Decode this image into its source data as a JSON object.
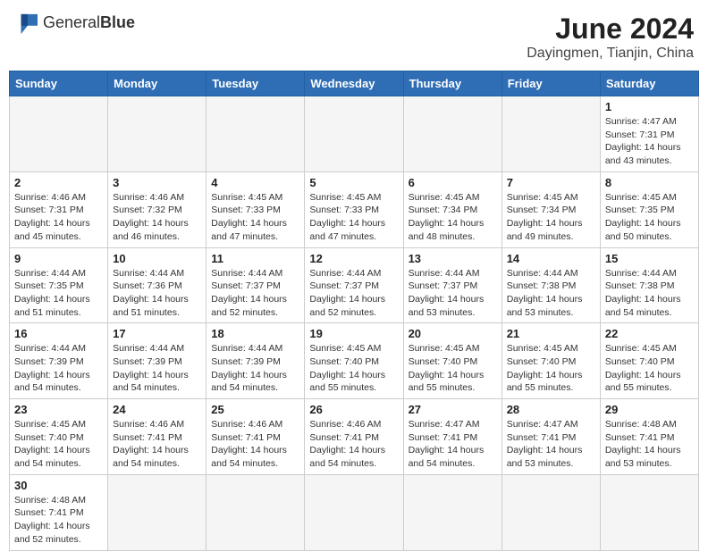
{
  "header": {
    "logo_general": "General",
    "logo_blue": "Blue",
    "month_title": "June 2024",
    "subtitle": "Dayingmen, Tianjin, China"
  },
  "weekdays": [
    "Sunday",
    "Monday",
    "Tuesday",
    "Wednesday",
    "Thursday",
    "Friday",
    "Saturday"
  ],
  "weeks": [
    [
      {
        "day": "",
        "info": ""
      },
      {
        "day": "",
        "info": ""
      },
      {
        "day": "",
        "info": ""
      },
      {
        "day": "",
        "info": ""
      },
      {
        "day": "",
        "info": ""
      },
      {
        "day": "",
        "info": ""
      },
      {
        "day": "1",
        "info": "Sunrise: 4:47 AM\nSunset: 7:31 PM\nDaylight: 14 hours\nand 43 minutes."
      }
    ],
    [
      {
        "day": "2",
        "info": "Sunrise: 4:46 AM\nSunset: 7:31 PM\nDaylight: 14 hours\nand 45 minutes."
      },
      {
        "day": "3",
        "info": "Sunrise: 4:46 AM\nSunset: 7:32 PM\nDaylight: 14 hours\nand 46 minutes."
      },
      {
        "day": "4",
        "info": "Sunrise: 4:45 AM\nSunset: 7:33 PM\nDaylight: 14 hours\nand 47 minutes."
      },
      {
        "day": "5",
        "info": "Sunrise: 4:45 AM\nSunset: 7:33 PM\nDaylight: 14 hours\nand 47 minutes."
      },
      {
        "day": "6",
        "info": "Sunrise: 4:45 AM\nSunset: 7:34 PM\nDaylight: 14 hours\nand 48 minutes."
      },
      {
        "day": "7",
        "info": "Sunrise: 4:45 AM\nSunset: 7:34 PM\nDaylight: 14 hours\nand 49 minutes."
      },
      {
        "day": "8",
        "info": "Sunrise: 4:45 AM\nSunset: 7:35 PM\nDaylight: 14 hours\nand 50 minutes."
      }
    ],
    [
      {
        "day": "9",
        "info": "Sunrise: 4:44 AM\nSunset: 7:35 PM\nDaylight: 14 hours\nand 51 minutes."
      },
      {
        "day": "10",
        "info": "Sunrise: 4:44 AM\nSunset: 7:36 PM\nDaylight: 14 hours\nand 51 minutes."
      },
      {
        "day": "11",
        "info": "Sunrise: 4:44 AM\nSunset: 7:37 PM\nDaylight: 14 hours\nand 52 minutes."
      },
      {
        "day": "12",
        "info": "Sunrise: 4:44 AM\nSunset: 7:37 PM\nDaylight: 14 hours\nand 52 minutes."
      },
      {
        "day": "13",
        "info": "Sunrise: 4:44 AM\nSunset: 7:37 PM\nDaylight: 14 hours\nand 53 minutes."
      },
      {
        "day": "14",
        "info": "Sunrise: 4:44 AM\nSunset: 7:38 PM\nDaylight: 14 hours\nand 53 minutes."
      },
      {
        "day": "15",
        "info": "Sunrise: 4:44 AM\nSunset: 7:38 PM\nDaylight: 14 hours\nand 54 minutes."
      }
    ],
    [
      {
        "day": "16",
        "info": "Sunrise: 4:44 AM\nSunset: 7:39 PM\nDaylight: 14 hours\nand 54 minutes."
      },
      {
        "day": "17",
        "info": "Sunrise: 4:44 AM\nSunset: 7:39 PM\nDaylight: 14 hours\nand 54 minutes."
      },
      {
        "day": "18",
        "info": "Sunrise: 4:44 AM\nSunset: 7:39 PM\nDaylight: 14 hours\nand 54 minutes."
      },
      {
        "day": "19",
        "info": "Sunrise: 4:45 AM\nSunset: 7:40 PM\nDaylight: 14 hours\nand 55 minutes."
      },
      {
        "day": "20",
        "info": "Sunrise: 4:45 AM\nSunset: 7:40 PM\nDaylight: 14 hours\nand 55 minutes."
      },
      {
        "day": "21",
        "info": "Sunrise: 4:45 AM\nSunset: 7:40 PM\nDaylight: 14 hours\nand 55 minutes."
      },
      {
        "day": "22",
        "info": "Sunrise: 4:45 AM\nSunset: 7:40 PM\nDaylight: 14 hours\nand 55 minutes."
      }
    ],
    [
      {
        "day": "23",
        "info": "Sunrise: 4:45 AM\nSunset: 7:40 PM\nDaylight: 14 hours\nand 54 minutes."
      },
      {
        "day": "24",
        "info": "Sunrise: 4:46 AM\nSunset: 7:41 PM\nDaylight: 14 hours\nand 54 minutes."
      },
      {
        "day": "25",
        "info": "Sunrise: 4:46 AM\nSunset: 7:41 PM\nDaylight: 14 hours\nand 54 minutes."
      },
      {
        "day": "26",
        "info": "Sunrise: 4:46 AM\nSunset: 7:41 PM\nDaylight: 14 hours\nand 54 minutes."
      },
      {
        "day": "27",
        "info": "Sunrise: 4:47 AM\nSunset: 7:41 PM\nDaylight: 14 hours\nand 54 minutes."
      },
      {
        "day": "28",
        "info": "Sunrise: 4:47 AM\nSunset: 7:41 PM\nDaylight: 14 hours\nand 53 minutes."
      },
      {
        "day": "29",
        "info": "Sunrise: 4:48 AM\nSunset: 7:41 PM\nDaylight: 14 hours\nand 53 minutes."
      }
    ],
    [
      {
        "day": "30",
        "info": "Sunrise: 4:48 AM\nSunset: 7:41 PM\nDaylight: 14 hours\nand 52 minutes."
      },
      {
        "day": "",
        "info": ""
      },
      {
        "day": "",
        "info": ""
      },
      {
        "day": "",
        "info": ""
      },
      {
        "day": "",
        "info": ""
      },
      {
        "day": "",
        "info": ""
      },
      {
        "day": "",
        "info": ""
      }
    ]
  ]
}
